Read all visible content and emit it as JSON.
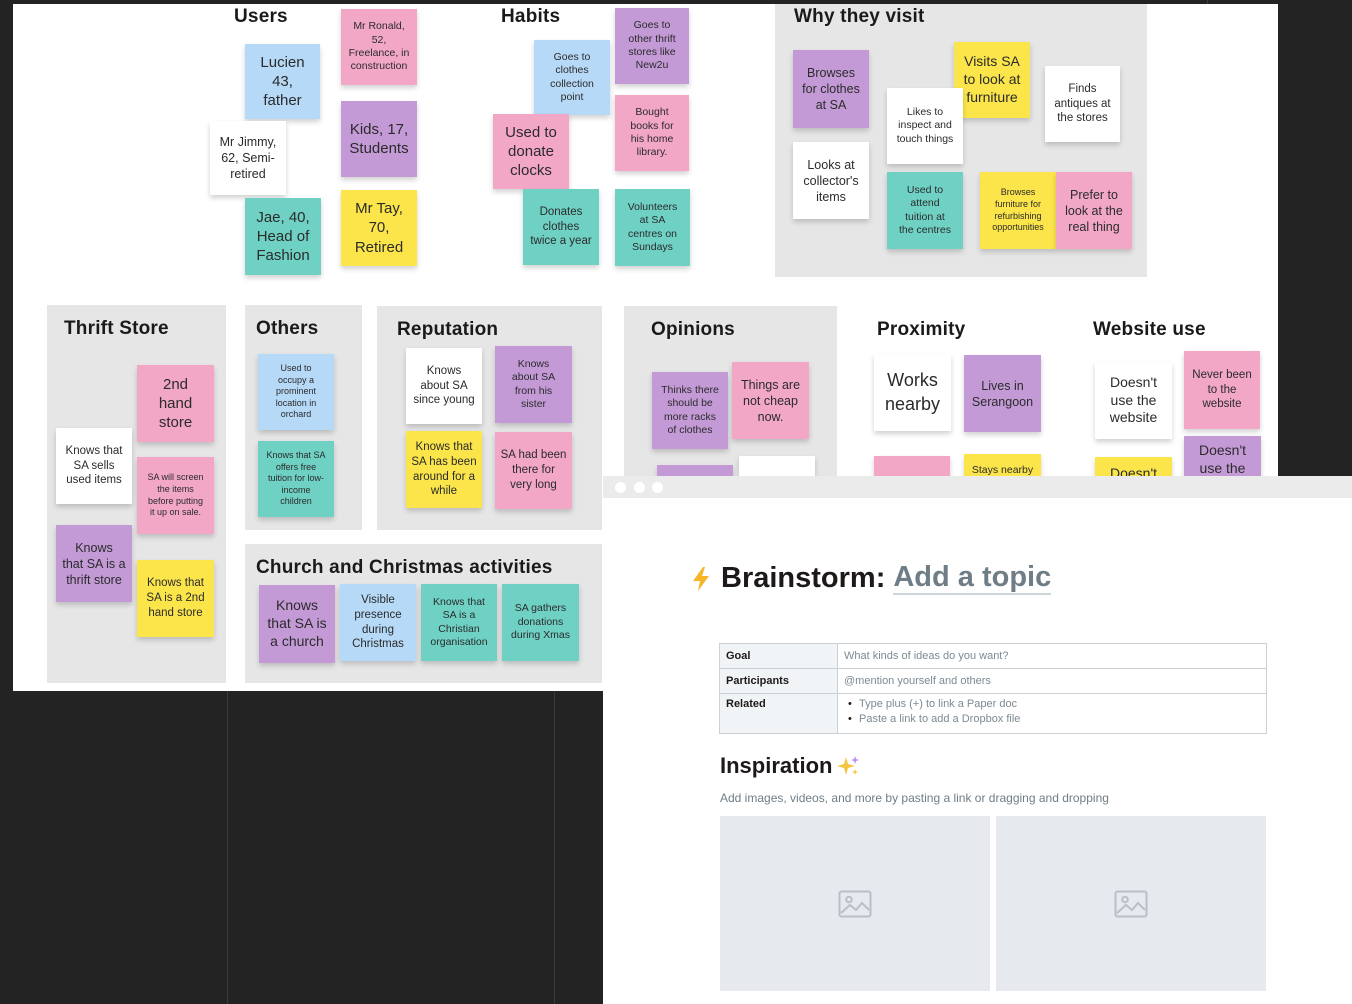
{
  "board": {
    "sections": {
      "users": "Users",
      "habits": "Habits",
      "why": "Why they visit",
      "thrift": "Thrift Store",
      "others": "Others",
      "reputation": "Reputation",
      "opinions": "Opinions",
      "proximity": "Proximity",
      "website": "Website use",
      "church": "Church and Christmas activities"
    },
    "users": {
      "ronald": "Mr Ronald,\n52,\nFreelance, in\nconstruction",
      "lucien": "Lucien\n43,\nfather",
      "jimmy": "Mr Jimmy,\n62, Semi-\nretired",
      "kids": "Kids, 17,\nStudents",
      "jae": "Jae, 40,\nHead of\nFashion",
      "tay": "Mr Tay,\n70,\nRetired"
    },
    "habits": {
      "other_thrift": "Goes to\nother thrift\nstores like\nNew2u",
      "collection": "Goes to\nclothes\ncollection\npoint",
      "bought_books": "Bought\nbooks for\nhis home\nlibrary.",
      "donate_clocks": "Used to\ndonate\nclocks",
      "donates_clothes": "Donates\nclothes\ntwice a year",
      "volunteers": "Volunteers\nat SA\ncentres on\nSundays"
    },
    "why": {
      "browses_clothes": "Browses\nfor clothes\nat SA",
      "furniture": "Visits SA\nto look at\nfurniture",
      "antiques": "Finds\nantiques at\nthe stores",
      "inspect": "Likes to\ninspect and\ntouch things",
      "collectors": "Looks at\ncollector's\nitems",
      "tuition": "Used to\nattend\ntuition at\nthe centres",
      "refurbish": "Browses\nfurniture for\nrefurbishing\nopportunities",
      "real_thing": "Prefer to\nlook at the\nreal thing"
    },
    "thrift": {
      "second_hand": "2nd\nhand\nstore",
      "sells_used": "Knows that\nSA sells\nused items",
      "screen": "SA will screen\nthe items\nbefore putting\nit up on sale.",
      "is_thrift": "Knows\nthat SA is a\nthrift store",
      "is_2nd": "Knows that\nSA is a 2nd\nhand store"
    },
    "others": {
      "occupy": "Used to\noccupy a\nprominent\nlocation in\norchard",
      "free_tuition": "Knows that SA\noffers free\ntuition for low-\nincome\nchildren"
    },
    "reputation": {
      "since_young": "Knows\nabout SA\nsince young",
      "from_sister": "Knows\nabout SA\nfrom his\nsister",
      "around": "Knows that\nSA has been\naround for a\nwhile",
      "very_long": "SA had been\nthere for\nvery long"
    },
    "opinions": {
      "more_racks": "Thinks there\nshould be\nmore racks\nof clothes",
      "not_cheap": "Things are\nnot cheap\nnow."
    },
    "proximity": {
      "works": "Works\nnearby",
      "serangoon": "Lives in\nSerangoon",
      "stays": "Stays nearby"
    },
    "website": {
      "doesnt_use": "Doesn't\nuse the\nwebsite",
      "never_been": "Never been\nto the\nwebsite",
      "doesnt_use2": "Doesn't\nuse the",
      "doesnt": "Doesn't"
    },
    "church": {
      "is_church": "Knows\nthat SA is\na church",
      "presence": "Visible\npresence\nduring\nChristmas",
      "christian": "Knows that\nSA is a\nChristian\norganisation",
      "donations": "SA gathers\ndonations\nduring Xmas"
    }
  },
  "paper": {
    "title_prefix": "Brainstorm:",
    "title_topic": "Add a topic",
    "table": {
      "goal_label": "Goal",
      "goal_value": "What kinds of ideas do you want?",
      "participants_label": "Participants",
      "participants_value": "@mention yourself and others",
      "related_label": "Related",
      "related_items": [
        "Type plus (+) to link a Paper doc",
        "Paste a link to add a Dropbox file"
      ]
    },
    "inspiration_title": "Inspiration",
    "inspiration_sub": "Add images, videos, and more by pasting a link or dragging and dropping",
    "colors": {
      "bolt": "#f7b528",
      "sparkle": "#f4c542",
      "sparkle_purple": "#b48cf2"
    },
    "icons": [
      "lightning-icon",
      "sparkle-icon",
      "image-placeholder-icon"
    ]
  }
}
